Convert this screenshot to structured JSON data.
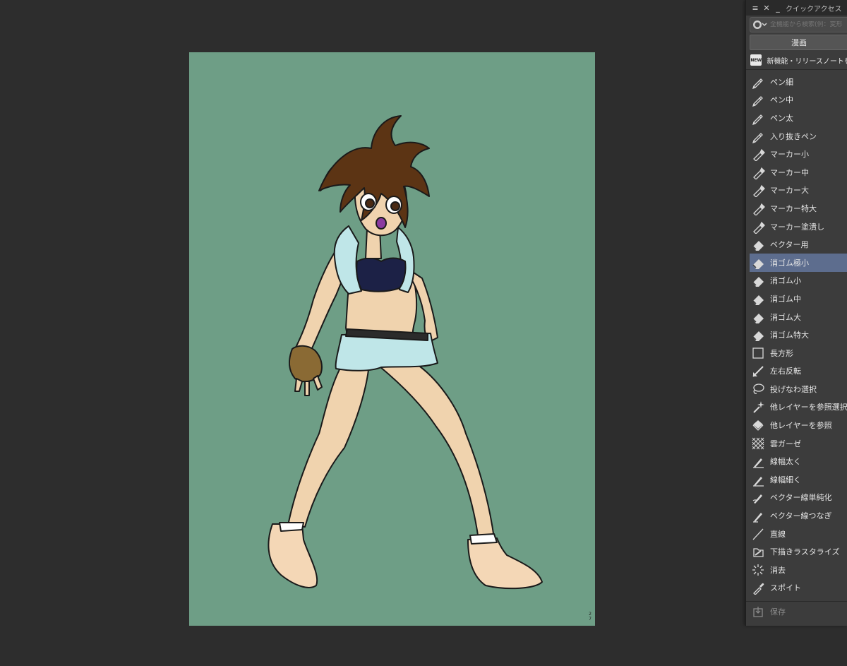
{
  "canvas": {
    "background": "#6e9e86",
    "page_number": "2\n7"
  },
  "panel": {
    "title": "クイックアクセス",
    "search": {
      "placeholder": "全機能から検索(例：変形"
    },
    "set_label": "漫画",
    "notes_label": "新機能・リリースノートを表示",
    "new_badge": "NEW",
    "selected_index": 10,
    "tools": [
      {
        "label": "ペン細",
        "icon": "pen-icon"
      },
      {
        "label": "ペン中",
        "icon": "pen-icon"
      },
      {
        "label": "ペン太",
        "icon": "pen-icon"
      },
      {
        "label": "入り抜きペン",
        "icon": "pen-icon"
      },
      {
        "label": "マーカー小",
        "icon": "marker-icon"
      },
      {
        "label": "マーカー中",
        "icon": "marker-icon"
      },
      {
        "label": "マーカー大",
        "icon": "marker-icon"
      },
      {
        "label": "マーカー特大",
        "icon": "marker-icon"
      },
      {
        "label": "マーカー塗潰し",
        "icon": "marker-icon"
      },
      {
        "label": "ベクター用",
        "icon": "eraser-icon"
      },
      {
        "label": "消ゴム極小",
        "icon": "eraser-icon"
      },
      {
        "label": "消ゴム小",
        "icon": "eraser-icon"
      },
      {
        "label": "消ゴム中",
        "icon": "eraser-icon"
      },
      {
        "label": "消ゴム大",
        "icon": "eraser-icon"
      },
      {
        "label": "消ゴム特大",
        "icon": "eraser-icon"
      },
      {
        "label": "長方形",
        "icon": "rectangle-icon"
      },
      {
        "label": "左右反転",
        "icon": "flip-icon"
      },
      {
        "label": "投げなわ選択",
        "icon": "lasso-icon"
      },
      {
        "label": "他レイヤーを参照選択",
        "icon": "magic-wand-icon"
      },
      {
        "label": "他レイヤーを参照",
        "icon": "fill-bucket-icon"
      },
      {
        "label": "雲ガーゼ",
        "icon": "gauze-icon"
      },
      {
        "label": "線幅太く",
        "icon": "line-width-icon"
      },
      {
        "label": "線幅細く",
        "icon": "line-width-icon"
      },
      {
        "label": "ベクター線単純化",
        "icon": "vector-simplify-icon"
      },
      {
        "label": "ベクター線つなぎ",
        "icon": "vector-connect-icon"
      },
      {
        "label": "直線",
        "icon": "straight-line-icon"
      },
      {
        "label": "下描きラスタライズ",
        "icon": "rasterize-icon"
      },
      {
        "label": "消去",
        "icon": "clear-icon"
      },
      {
        "label": "スポイト",
        "icon": "eyedropper-icon"
      }
    ],
    "save_label": "保存"
  },
  "colors": {
    "workspace": "#2d2d2d",
    "panel": "#3c3c3c",
    "selection": "#5d6d8e",
    "skin": "#f0d3ae",
    "hair": "#5c3414",
    "vest": "#bfe6e8",
    "top": "#1c2146"
  }
}
